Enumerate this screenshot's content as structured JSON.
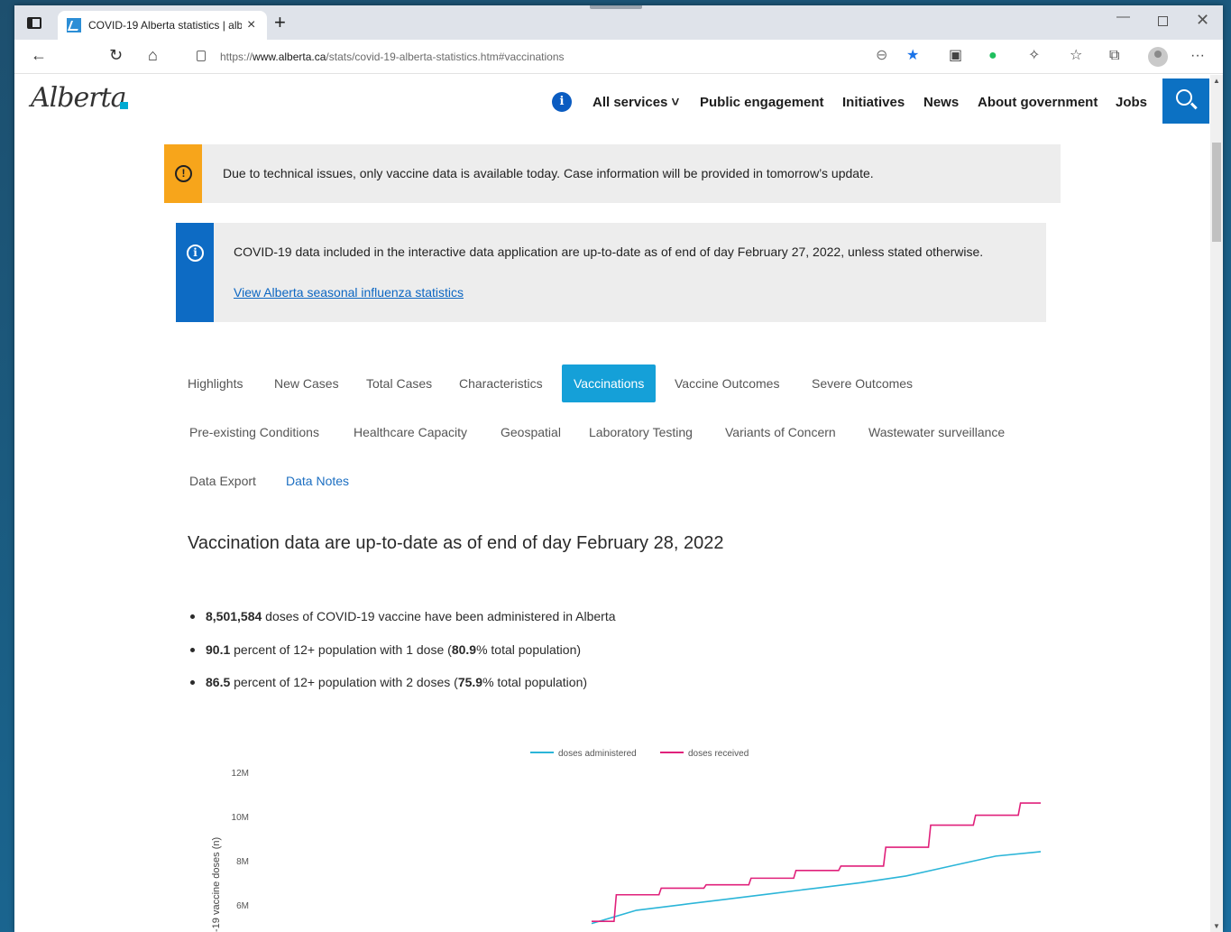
{
  "browser": {
    "tab_title": "COVID-19 Alberta statistics | alb",
    "tab_close": "×",
    "new_tab": "+",
    "url_prefix": "https://",
    "url_host": "www.alberta.ca",
    "url_path": "/stats/covid-19-alberta-statistics.htm#vaccinations",
    "min": "—",
    "close": "✕",
    "more": "···"
  },
  "site": {
    "logo": "Alberta",
    "info_icon": "i",
    "nav": [
      "All services ˅",
      "Public engagement",
      "Initiatives",
      "News",
      "About government",
      "Jobs"
    ]
  },
  "alerts": {
    "warning_icon": "!",
    "warning_text": "Due to technical issues, only vaccine data is available today. Case information will be provided in tomorrow’s update.",
    "info_icon": "i",
    "info_text": "COVID-19 data included in the interactive data application are up-to-date as of end of day February 27, 2022, unless stated otherwise.",
    "info_link": "View Alberta seasonal influenza statistics"
  },
  "tabs": {
    "row1": [
      "Highlights",
      "New Cases",
      "Total Cases",
      "Characteristics",
      "Vaccinations",
      "Vaccine Outcomes",
      "Severe Outcomes"
    ],
    "row2": [
      "Pre-existing Conditions",
      "Healthcare Capacity",
      "Geospatial",
      "Laboratory Testing",
      "Variants of Concern",
      "Wastewater surveillance"
    ],
    "row3": [
      "Data Export",
      "Data Notes"
    ],
    "active": "Vaccinations"
  },
  "content": {
    "heading": "Vaccination data are up-to-date as of end of day February 28, 2022",
    "b1_value": "8,501,584",
    "b1_text": " doses of COVID-19 vaccine have been administered in Alberta",
    "b2_value": "90.1",
    "b2_text_a": " percent of 12+ population with 1 dose (",
    "b2_value2": "80.9",
    "b2_text_b": "% total population)",
    "b3_value": "86.5",
    "b3_text_a": " percent of 12+ population with 2 doses (",
    "b3_value2": "75.9",
    "b3_text_b": "% total population)"
  },
  "chart_data": {
    "type": "line",
    "ylabel": "-19 vaccine doses (n)",
    "y_ticks": [
      "12M",
      "10M",
      "8M",
      "6M"
    ],
    "ylim_visible": [
      5000000,
      12500000
    ],
    "grid": false,
    "legend_position": "top-center",
    "series": [
      {
        "name": "doses administered",
        "color": "#2bb5d8",
        "x": [
          0,
          10,
          20,
          30,
          40,
          50,
          60,
          70,
          80,
          90,
          100
        ],
        "values": [
          5200000,
          5800000,
          6050000,
          6300000,
          6550000,
          6800000,
          7050000,
          7350000,
          7800000,
          8250000,
          8450000
        ]
      },
      {
        "name": "doses received",
        "color": "#e0217b",
        "x": [
          0,
          10,
          20,
          30,
          40,
          50,
          60,
          70,
          80,
          90,
          100
        ],
        "values": [
          5300000,
          6500000,
          6800000,
          6950000,
          7250000,
          7600000,
          7800000,
          8650000,
          9650000,
          10100000,
          10650000
        ]
      }
    ]
  },
  "colors": {
    "warning": "#f7a51b",
    "info": "#0d6bc4",
    "active_tab": "#15a0d8",
    "link": "#0c66c2"
  }
}
